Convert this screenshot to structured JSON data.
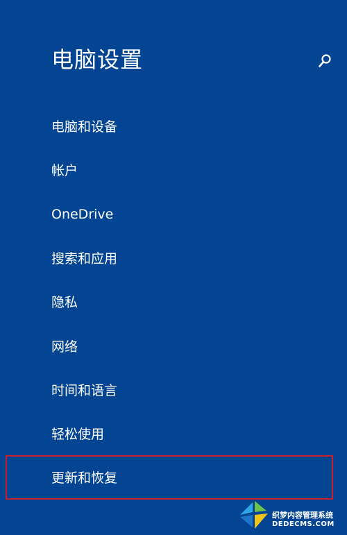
{
  "header": {
    "title": "电脑设置",
    "search_icon": "search-icon"
  },
  "nav": {
    "items": [
      {
        "label": "电脑和设备"
      },
      {
        "label": "帐户"
      },
      {
        "label": "OneDrive"
      },
      {
        "label": "搜索和应用"
      },
      {
        "label": "隐私"
      },
      {
        "label": "网络"
      },
      {
        "label": "时间和语言"
      },
      {
        "label": "轻松使用"
      },
      {
        "label": "更新和恢复"
      }
    ]
  },
  "colors": {
    "background": "#034593",
    "text": "#ffffff",
    "highlight_border": "#c8202c"
  },
  "watermark": {
    "line1": "织梦内容管理系统",
    "line2": "DEDECMS.COM"
  }
}
